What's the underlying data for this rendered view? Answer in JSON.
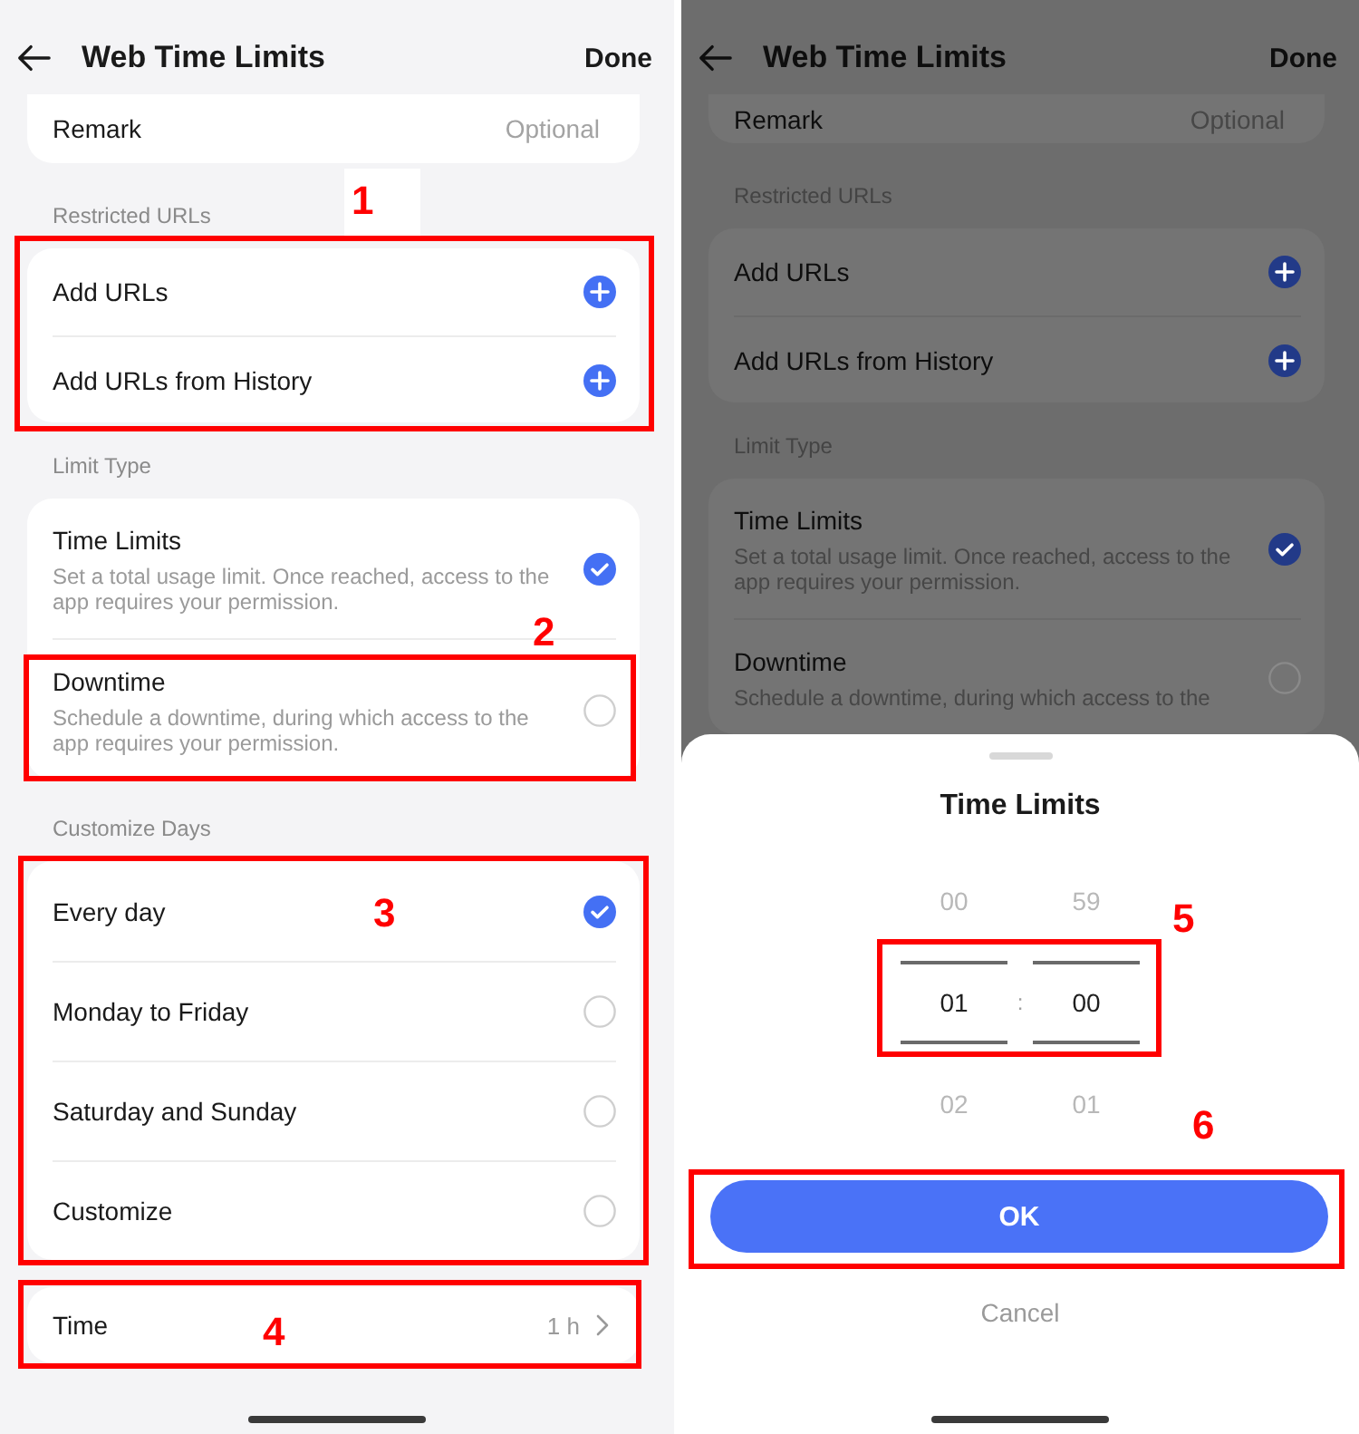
{
  "screens": [
    {
      "dimmed": false,
      "header": {
        "title": "Web Time Limits",
        "action": "Done"
      },
      "remark": {
        "label": "Remark",
        "placeholder": "Optional"
      },
      "restricted_urls": {
        "heading": "Restricted URLs",
        "annotation": "1",
        "items": [
          {
            "label": "Add URLs"
          },
          {
            "label": "Add URLs from History"
          }
        ]
      },
      "limit_type": {
        "heading": "Limit Type",
        "options": [
          {
            "title": "Time Limits",
            "description": "Set a total usage limit. Once reached, access to the app requires your permission.",
            "selected": true
          },
          {
            "title": "Downtime",
            "description": "Schedule a downtime, during which access to the app requires your permission.",
            "selected": false,
            "annotation": "2"
          }
        ]
      },
      "customize_days": {
        "heading": "Customize Days",
        "annotation": "3",
        "options": [
          {
            "label": "Every day",
            "selected": true
          },
          {
            "label": "Monday to Friday",
            "selected": false
          },
          {
            "label": "Saturday and Sunday",
            "selected": false
          },
          {
            "label": "Customize",
            "selected": false
          }
        ]
      },
      "time": {
        "label": "Time",
        "value": "1 h",
        "annotation": "4"
      }
    },
    {
      "dimmed": true,
      "header": {
        "title": "Web Time Limits",
        "action": "Done"
      },
      "remark": {
        "label": "Remark",
        "placeholder": "Optional"
      },
      "restricted_urls": {
        "heading": "Restricted URLs",
        "items": [
          {
            "label": "Add URLs"
          },
          {
            "label": "Add URLs from History"
          }
        ]
      },
      "limit_type": {
        "heading": "Limit Type",
        "options": [
          {
            "title": "Time Limits",
            "description": "Set a total usage limit. Once reached, access to the app requires your permission.",
            "selected": true
          },
          {
            "title": "Downtime",
            "description": "Schedule a downtime, during which access to the",
            "selected": false
          }
        ]
      },
      "sheet": {
        "title": "Time Limits",
        "picker": {
          "annotation": "5",
          "separator": ":",
          "columns": [
            {
              "items": [
                {
                  "value": "00",
                  "selected": false
                },
                {
                  "value": "01",
                  "selected": true
                },
                {
                  "value": "02",
                  "selected": false
                }
              ]
            },
            {
              "items": [
                {
                  "value": "59",
                  "selected": false
                },
                {
                  "value": "00",
                  "selected": true
                },
                {
                  "value": "01",
                  "selected": false
                }
              ]
            }
          ]
        },
        "confirm": {
          "label": "OK",
          "annotation": "6"
        },
        "cancel": {
          "label": "Cancel"
        }
      }
    }
  ]
}
